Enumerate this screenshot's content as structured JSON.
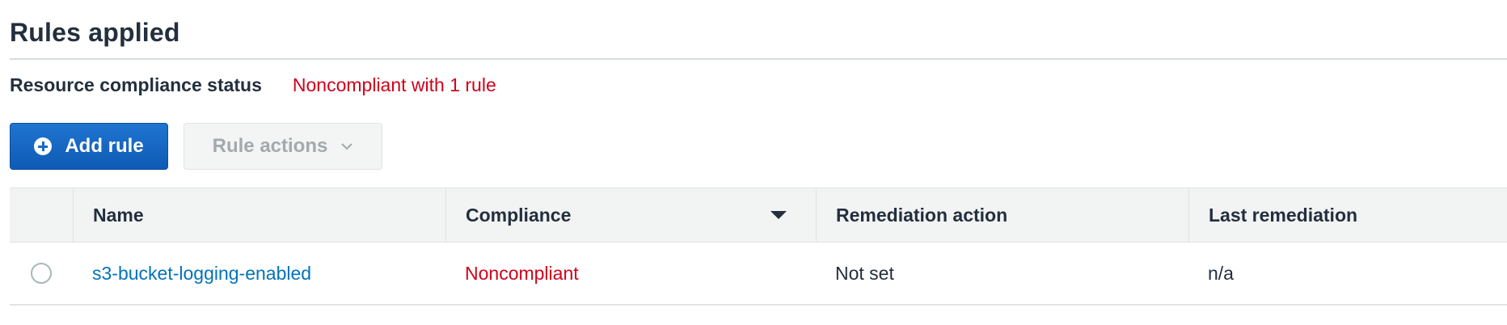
{
  "section": {
    "title": "Rules applied"
  },
  "status": {
    "label": "Resource compliance status",
    "value": "Noncompliant with 1 rule"
  },
  "toolbar": {
    "add_rule_label": "Add rule",
    "add_rule_icon": "plus-circle-icon",
    "rule_actions_label": "Rule actions",
    "rule_actions_icon": "chevron-down-icon",
    "rule_actions_disabled": true
  },
  "table": {
    "columns": [
      "Name",
      "Compliance",
      "Remediation action",
      "Last remediation"
    ],
    "sorted_column": "Compliance",
    "sort_direction": "descending",
    "rows": [
      {
        "selected": false,
        "name": "s3-bucket-logging-enabled",
        "compliance": "Noncompliant",
        "remediation_action": "Not set",
        "last_remediation": "n/a"
      }
    ]
  },
  "colors": {
    "primary": "#1a6ac7",
    "link": "#0073bb",
    "noncompliant": "#d0021b",
    "header_bg": "#f2f3f3"
  }
}
